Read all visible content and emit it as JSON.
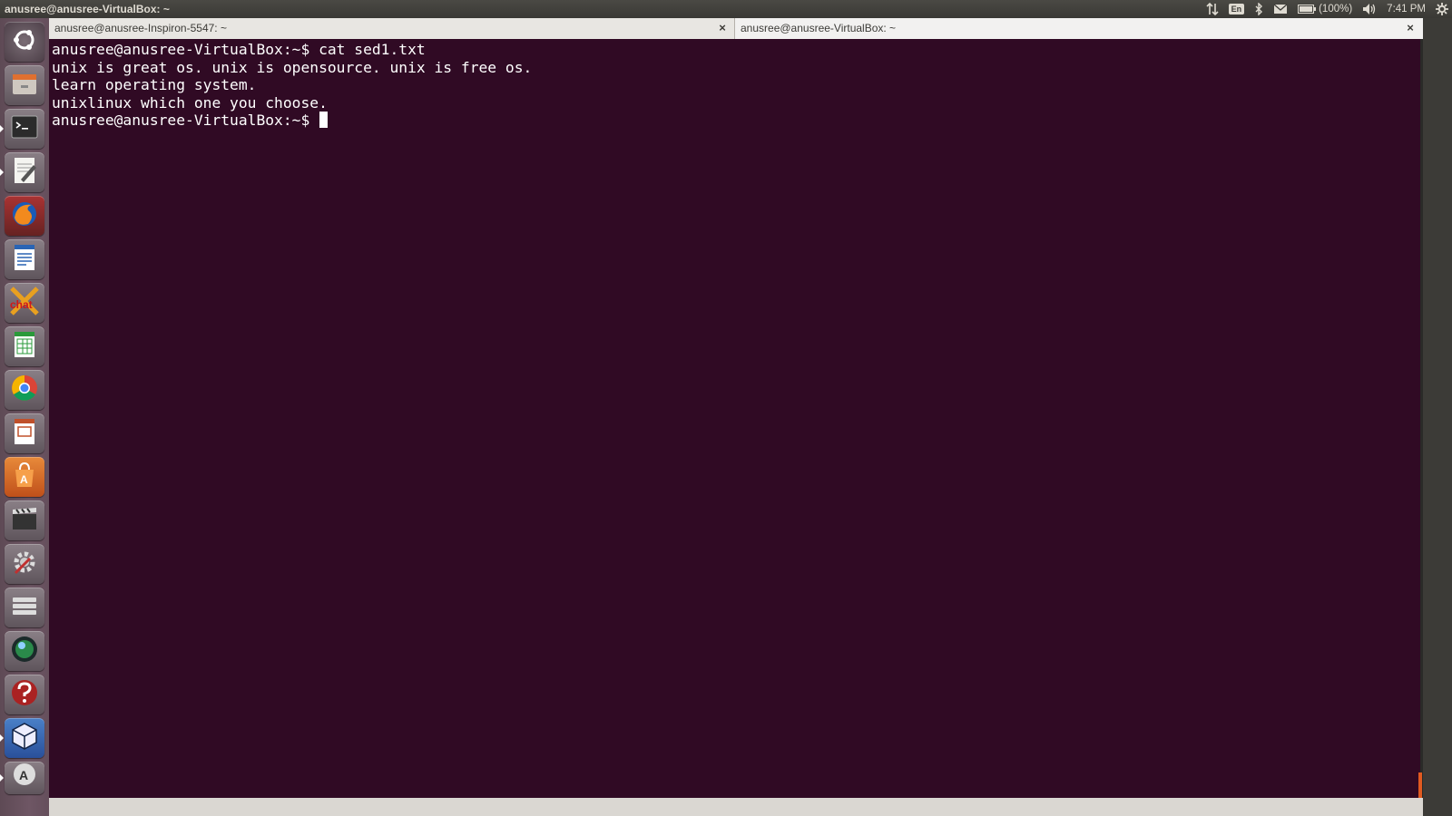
{
  "top_panel": {
    "window_title": "anusree@anusree-VirtualBox: ~",
    "keyboard_layout": "En",
    "battery_text": "(100%)",
    "clock": "7:41 PM"
  },
  "tabs": [
    {
      "label": "anusree@anusree-Inspiron-5547: ~"
    },
    {
      "label": "anusree@anusree-VirtualBox: ~"
    }
  ],
  "tab_close_glyph": "×",
  "terminal": {
    "lines": [
      "anusree@anusree-VirtualBox:~$ cat sed1.txt",
      "unix is great os. unix is opensource. unix is free os.",
      "learn operating system.",
      "unixlinux which one you choose."
    ],
    "prompt": "anusree@anusree-VirtualBox:~$ "
  },
  "launcher_icons": [
    "ubuntu-dash-icon",
    "files-icon",
    "terminal-icon",
    "text-editor-icon",
    "firefox-icon",
    "libreoffice-writer-icon",
    "xchat-icon",
    "libreoffice-calc-icon",
    "chrome-icon",
    "libreoffice-impress-icon",
    "software-center-icon",
    "video-editor-icon",
    "system-settings-icon",
    "disks-icon",
    "globe-browser-icon",
    "help-icon",
    "virtualbox-icon",
    "software-updater-icon"
  ],
  "colors": {
    "terminal_bg": "#300a24",
    "terminal_fg": "#ffffff",
    "panel_bg": "#3c3b37"
  }
}
